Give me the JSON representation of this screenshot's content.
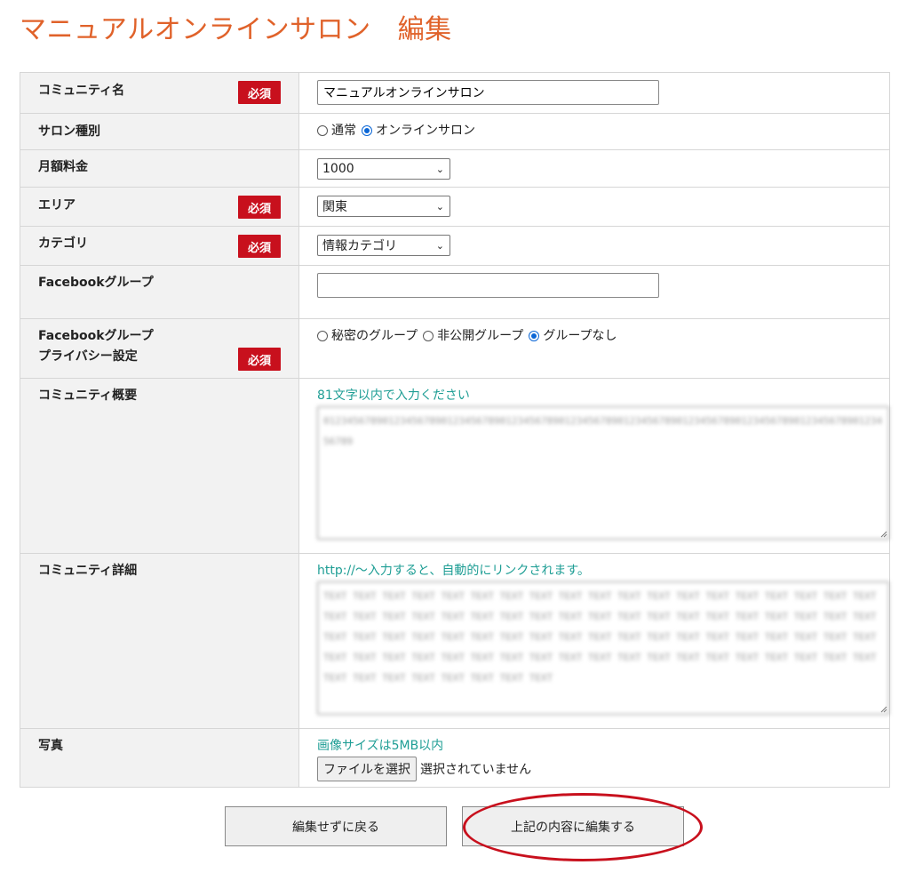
{
  "page": {
    "title_main": "マニュアルオンラインサロン",
    "title_suffix": "編集"
  },
  "badges": {
    "required": "必須"
  },
  "form": {
    "community_name": {
      "label": "コミュニティ名",
      "value": "マニュアルオンラインサロン"
    },
    "salon_type": {
      "label": "サロン種別",
      "options": [
        {
          "label": "通常",
          "checked": false
        },
        {
          "label": "オンラインサロン",
          "checked": true
        }
      ]
    },
    "monthly_fee": {
      "label": "月額料金",
      "value": "1000"
    },
    "area": {
      "label": "エリア",
      "value": "関東"
    },
    "category": {
      "label": "カテゴリ",
      "value": "情報カテゴリ"
    },
    "facebook_group": {
      "label": "Facebookグループ",
      "value": ""
    },
    "facebook_privacy": {
      "label_line1": "Facebookグループ",
      "label_line2": "プライバシー設定",
      "options": [
        {
          "label": "秘密のグループ",
          "checked": false
        },
        {
          "label": "非公開グループ",
          "checked": false
        },
        {
          "label": "グループなし",
          "checked": true
        }
      ]
    },
    "summary": {
      "label": "コミュニティ概要",
      "hint": "81文字以内で入力ください",
      "value": "0123456789012345678901234567890123456789012345678901234567890123456789012345678901234567890123456789"
    },
    "detail": {
      "label": "コミュニティ詳細",
      "hint": "http://～入力すると、自動的にリンクされます。",
      "value": "TEXT TEXT TEXT TEXT TEXT TEXT TEXT TEXT TEXT TEXT TEXT TEXT TEXT TEXT TEXT TEXT TEXT TEXT TEXT TEXT TEXT TEXT TEXT TEXT TEXT TEXT TEXT TEXT TEXT TEXT TEXT TEXT TEXT TEXT TEXT TEXT TEXT TEXT TEXT TEXT TEXT TEXT TEXT TEXT TEXT TEXT TEXT TEXT TEXT TEXT TEXT TEXT TEXT TEXT TEXT TEXT TEXT TEXT TEXT TEXT TEXT TEXT TEXT TEXT TEXT TEXT TEXT TEXT TEXT TEXT TEXT TEXT TEXT TEXT TEXT TEXT TEXT TEXT TEXT TEXT TEXT TEXT TEXT TEXT"
    },
    "photo": {
      "label": "写真",
      "hint": "画像サイズは5MB以内",
      "button": "ファイルを選択",
      "status": "選択されていません"
    }
  },
  "actions": {
    "back": "編集せずに戻る",
    "submit": "上記の内容に編集する"
  },
  "colors": {
    "title": "#e0622a",
    "required_badge": "#c8101d",
    "hint": "#1f9e95",
    "highlight": "#c8101d"
  }
}
